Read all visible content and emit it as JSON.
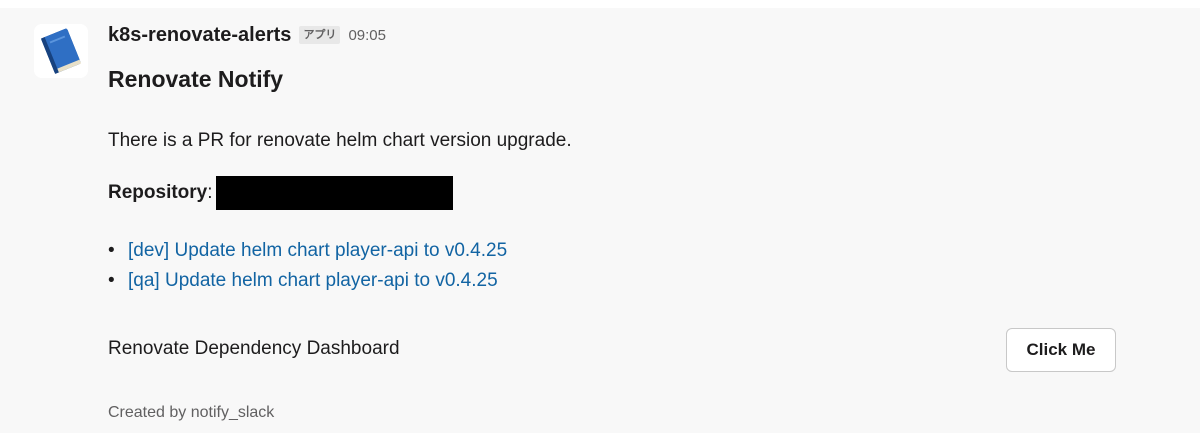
{
  "message": {
    "sender": "k8s-renovate-alerts",
    "app_badge": "アプリ",
    "time": "09:05",
    "avatar_icon": "blue-book-icon",
    "title": "Renovate Notify",
    "body": "There is a PR for renovate helm chart version upgrade.",
    "repository_label": "Repository",
    "repository_colon": ":",
    "pr_links": [
      {
        "bullet": "•",
        "label": "[dev] Update helm chart player-api to v0.4.25"
      },
      {
        "bullet": "•",
        "label": "[qa] Update helm chart player-api to v0.4.25"
      }
    ],
    "dashboard_text": "Renovate Dependency Dashboard",
    "button_label": "Click Me",
    "footer": "Created by notify_slack"
  },
  "colors": {
    "background": "#f8f8f8",
    "link": "#1264a3",
    "text": "#1d1c1d",
    "muted": "#616061",
    "book_blue": "#2f6fc4"
  }
}
